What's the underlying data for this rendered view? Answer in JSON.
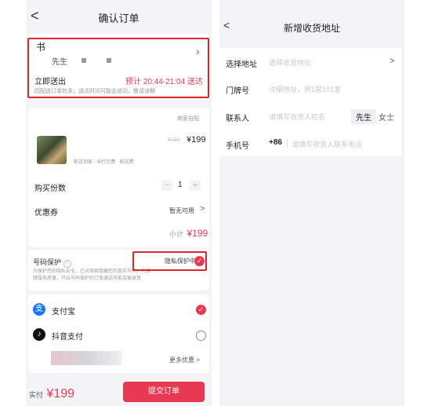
{
  "left": {
    "header": {
      "back": "<",
      "title": "确认订单"
    },
    "address": {
      "line1": "书",
      "name_suffix": "先生",
      "delivery_label": "立即送出",
      "eta": "预计 20:44-21:04 送达",
      "note": "因配送订单较多，送达时间可能会波动，敬请谅解"
    },
    "shop": {
      "tag": "商家自配"
    },
    "item": {
      "desc": "配送到家 · 含打包费 · 配送费",
      "old_price": "¥784",
      "price": "¥199"
    },
    "quantity": {
      "label": "购买份数",
      "minus": "−",
      "value": "1",
      "plus": "+"
    },
    "coupon": {
      "label": "优惠券",
      "value": "暂无可用",
      "chevron": ">"
    },
    "subtotal": {
      "label": "小计",
      "value": "¥199"
    },
    "privacy": {
      "label": "号码保护",
      "status": "隐私保护中",
      "desc": "为保护您的隐私安全，已对商家隐藏您的真实号码，为保障服务质量，开启号码保护的订单通话可能会被录音"
    },
    "payment": {
      "alipay": "支付宝",
      "douyin": "抖音支付",
      "more": "更多优惠",
      "more_chevron": ">"
    },
    "footer": {
      "paid_label": "实付",
      "paid_value": "¥199",
      "submit": "提交订单"
    }
  },
  "right": {
    "header": {
      "back": "<",
      "title": "新增收货地址"
    },
    "form": [
      {
        "label": "选择地址",
        "placeholder": "选择收货地址",
        "chevron": ">"
      },
      {
        "label": "门牌号",
        "placeholder": "详细地址，例1层101室"
      },
      {
        "label": "联系人",
        "placeholder": "请填写收货人姓名",
        "options": [
          "先生",
          "女士"
        ]
      },
      {
        "label": "手机号",
        "prefix": "+86",
        "placeholder": "请填写收货人联系电话"
      }
    ]
  },
  "colors": {
    "accent": "#e83852",
    "highlight_box": "#d9262c",
    "panel": "#f4f4f6"
  }
}
